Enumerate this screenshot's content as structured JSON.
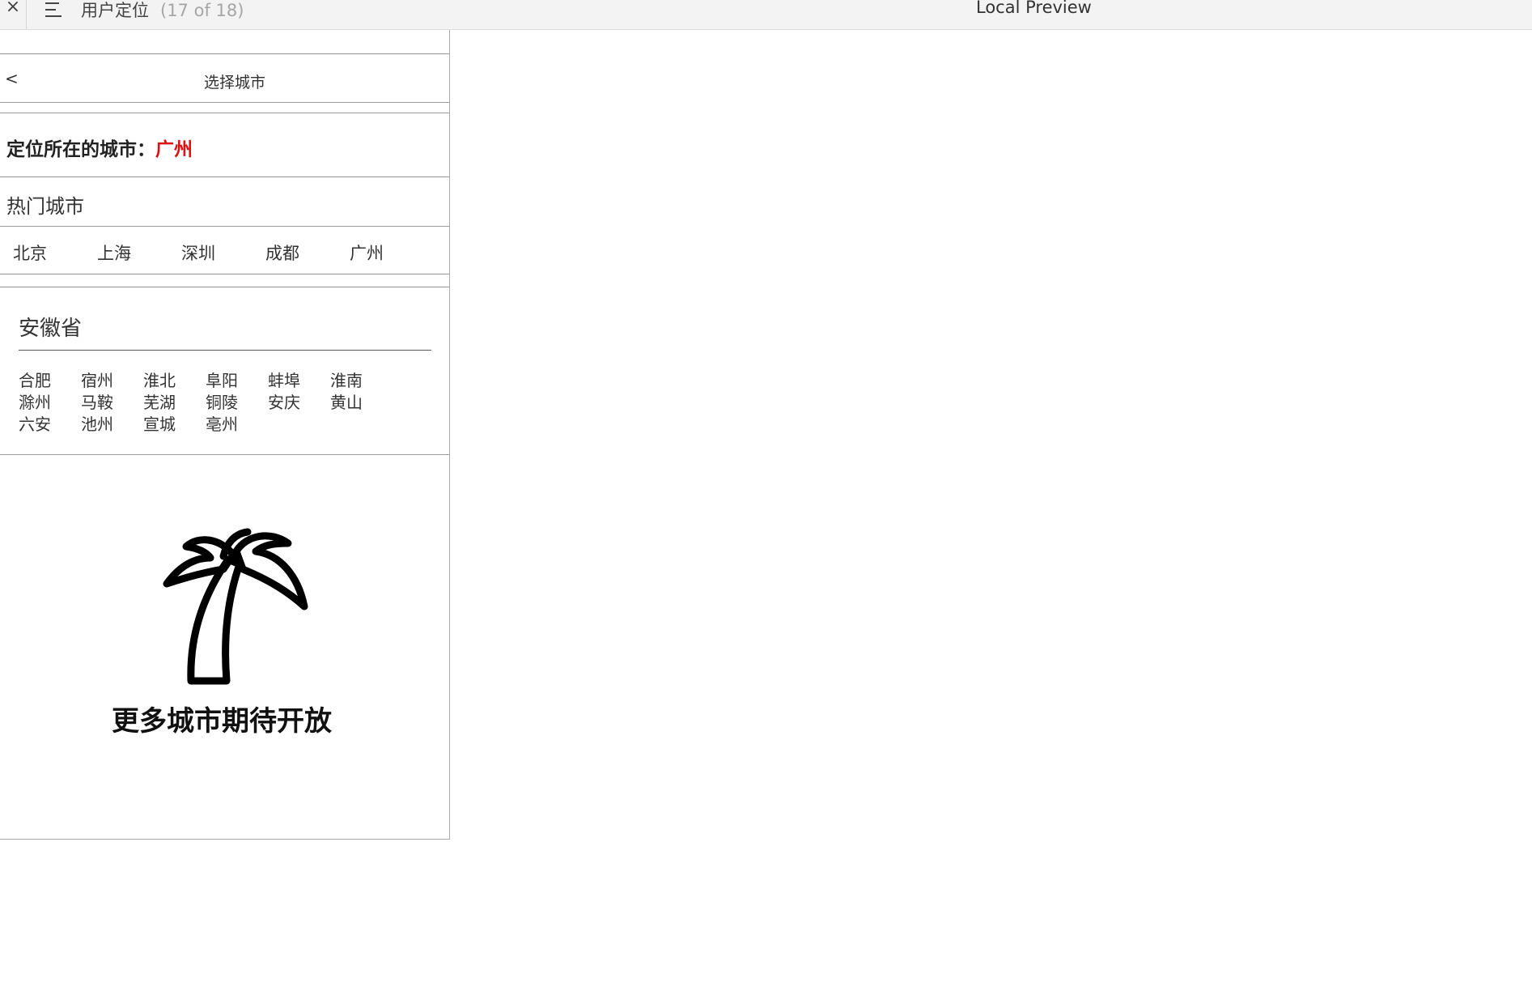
{
  "topbar": {
    "close_glyph": "×",
    "close_icon": "close-icon",
    "menu_icon": "hamburger-menu-icon",
    "page_name": "用户定位",
    "page_count": "(17 of 18)",
    "window_title": "Local Preview"
  },
  "nav": {
    "back_label": "<",
    "title": "选择城市"
  },
  "location": {
    "label": "定位所在的城市：",
    "city": "广州",
    "city_color": "#dd1111"
  },
  "hot": {
    "title": "热门城市",
    "cities": [
      "北京",
      "上海",
      "深圳",
      "成都",
      "广州"
    ]
  },
  "province": {
    "name": "安徽省",
    "cities": [
      "合肥",
      "宿州",
      "淮北",
      "阜阳",
      "蚌埠",
      "淮南",
      "滁州",
      "马鞍",
      "芜湖",
      "铜陵",
      "安庆",
      "黄山",
      "六安",
      "池州",
      "宣城",
      "亳州"
    ]
  },
  "footer": {
    "icon": "palm-tree-icon",
    "message": "更多城市期待开放"
  }
}
